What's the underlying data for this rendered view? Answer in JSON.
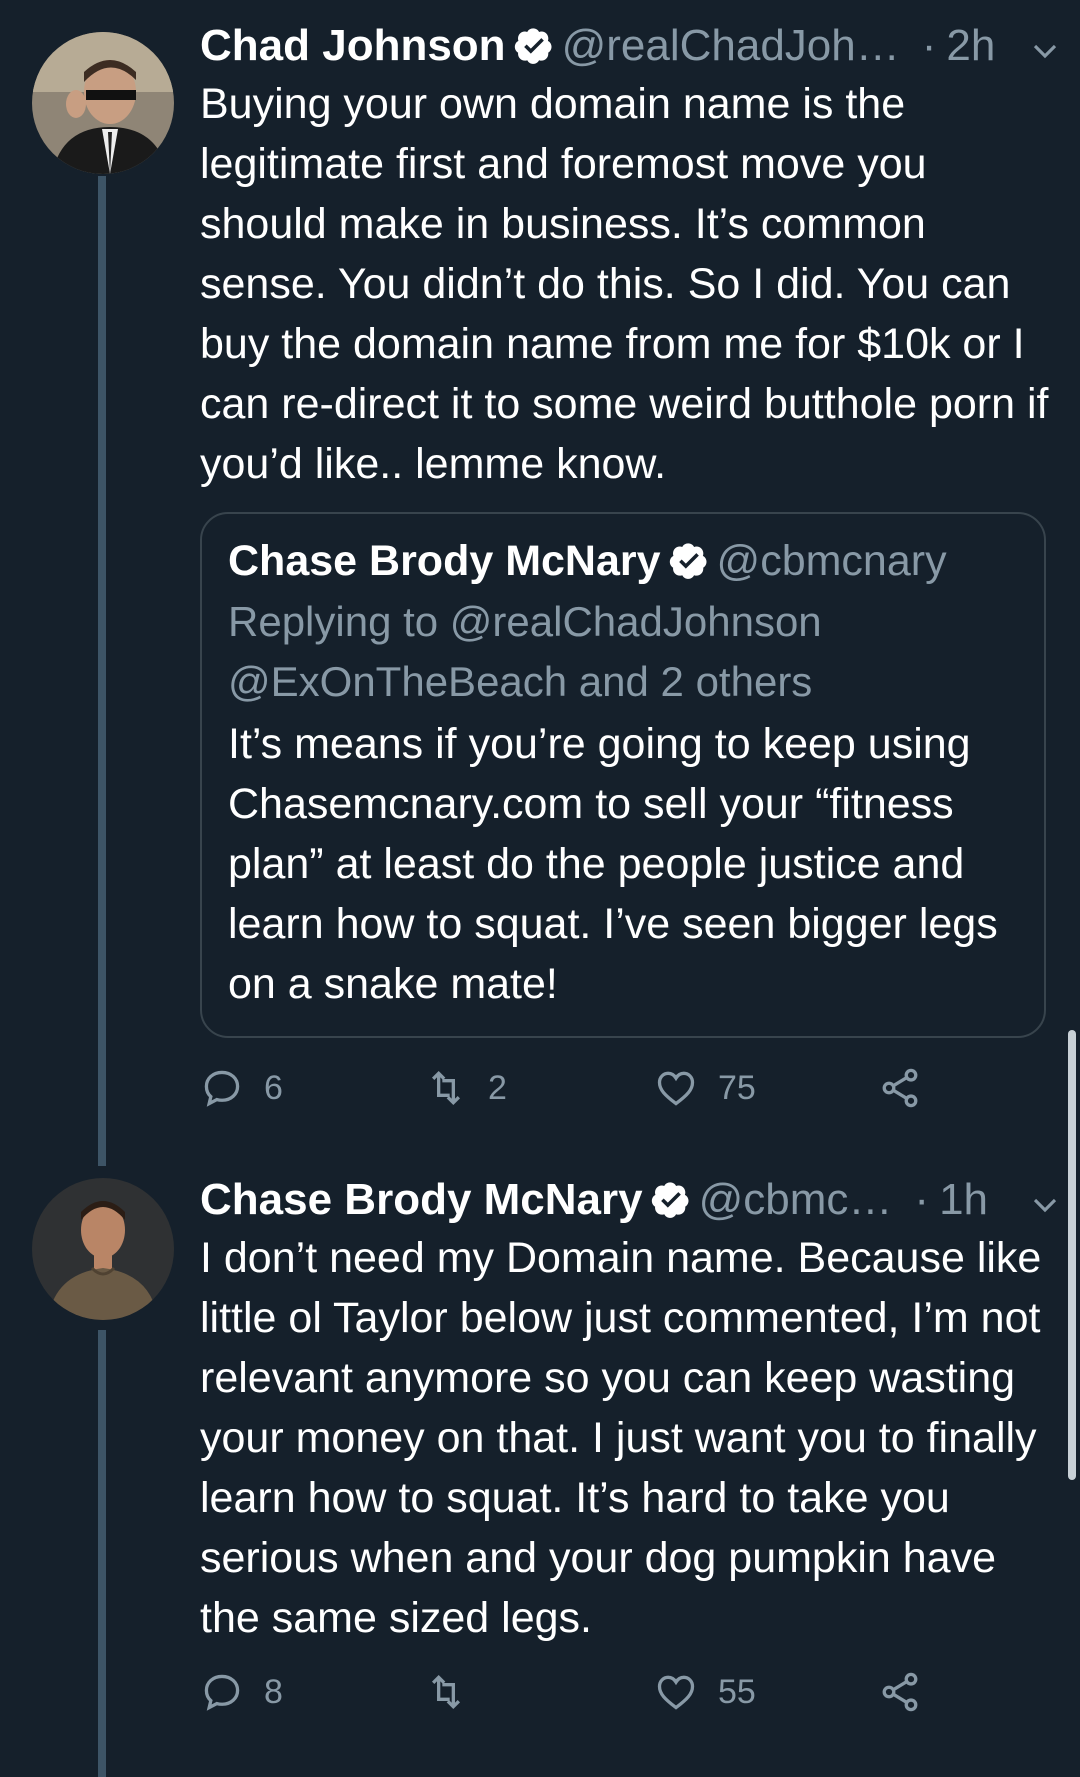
{
  "colors": {
    "background": "#15202b",
    "secondary_text": "#8899a6",
    "thread_line": "#3d5466",
    "border": "#38444d",
    "verified_badge": "#ffffff"
  },
  "tweets": [
    {
      "name": "Chad Johnson",
      "handle": "@realChadJoh…",
      "time": "2h",
      "avatar_icon": "avatar-photo",
      "text": "Buying your own domain name is the legitimate first and foremost move you should make in business. It’s common sense. You didn’t do this. So I did. You can buy the domain name from me for $10k or I can re-direct it to some weird butthole porn if you’d like.. lemme know.",
      "quote": {
        "name": "Chase Brody McNary",
        "handle": "@cbmcnary",
        "reply_line1": "Replying to @realChadJohnson",
        "reply_line2": "@ExOnTheBeach and 2 others",
        "text": "It’s means if you’re going to keep using Chasemcnary.com to sell your “fitness plan” at least do the people justice and learn how to squat.   I’ve seen bigger legs on a snake mate!"
      },
      "actions": {
        "replies": "6",
        "retweets": "2",
        "likes": "75"
      }
    },
    {
      "name": "Chase Brody McNary",
      "handle": "@cbmc…",
      "time": "1h",
      "avatar_icon": "avatar-photo",
      "text": "I don’t need my Domain name. Because like little ol Taylor below just commented, I’m not relevant anymore so you can keep wasting your money on that.  I just want you to finally learn how to squat.  It’s hard to take you serious when and your dog pumpkin have the same sized legs.",
      "actions": {
        "replies": "8",
        "retweets": "",
        "likes": "55"
      }
    }
  ]
}
